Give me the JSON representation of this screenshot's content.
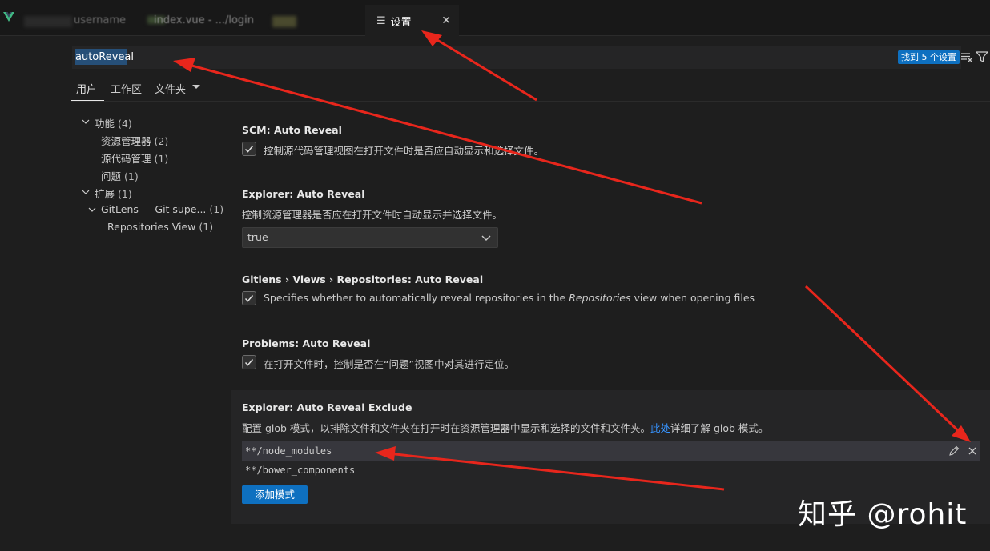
{
  "tabs": {
    "username_label": "username",
    "index_label": "index.vue - .../login",
    "settings_label": "设置",
    "settings_icon": "settings-list-icon",
    "close_glyph": "✕"
  },
  "search": {
    "value": "autoReveal",
    "result_badge": "找到 5 个设置"
  },
  "scopes": {
    "user": "用户",
    "workspace": "工作区",
    "folder": "文件夹"
  },
  "toc": [
    {
      "label": "功能",
      "count": "(4)"
    },
    {
      "label": "资源管理器",
      "count": "(2)"
    },
    {
      "label": "源代码管理",
      "count": "(1)"
    },
    {
      "label": "问题",
      "count": "(1)"
    },
    {
      "label": "扩展",
      "count": "(1)"
    },
    {
      "label": "GitLens — Git supe...",
      "count": "(1)"
    },
    {
      "label": "Repositories View",
      "count": "(1)"
    }
  ],
  "settings": {
    "scm": {
      "title": "SCM: Auto Reveal",
      "desc": "控制源代码管理视图在打开文件时是否应自动显示和选择文件。",
      "checked": true
    },
    "explorer": {
      "title": "Explorer: Auto Reveal",
      "desc": "控制资源管理器是否应在打开文件时自动显示并选择文件。",
      "value": "true"
    },
    "gitlens": {
      "title": "Gitlens › Views › Repositories: Auto Reveal",
      "desc_before": "Specifies whether to automatically reveal repositories in the ",
      "desc_italic": "Repositories",
      "desc_after": " view when opening files",
      "checked": true
    },
    "problems": {
      "title": "Problems: Auto Reveal",
      "desc": "在打开文件时，控制是否在“问题”视图中对其进行定位。",
      "checked": true
    },
    "exclude": {
      "title": "Explorer: Auto Reveal Exclude",
      "desc_before": "配置 glob 模式，以排除文件和文件夹在打开时在资源管理器中显示和选择的文件和文件夹。",
      "link": "此处",
      "desc_after": "详细了解 glob 模式。",
      "patterns": [
        "**/node_modules",
        "**/bower_components"
      ],
      "add_button": "添加模式"
    }
  },
  "watermark": "知乎 @rohit",
  "colors": {
    "background": "#1e1e1e",
    "accent": "#0e70c0",
    "link": "#3794ff",
    "annotation_arrow": "#e8261c"
  }
}
